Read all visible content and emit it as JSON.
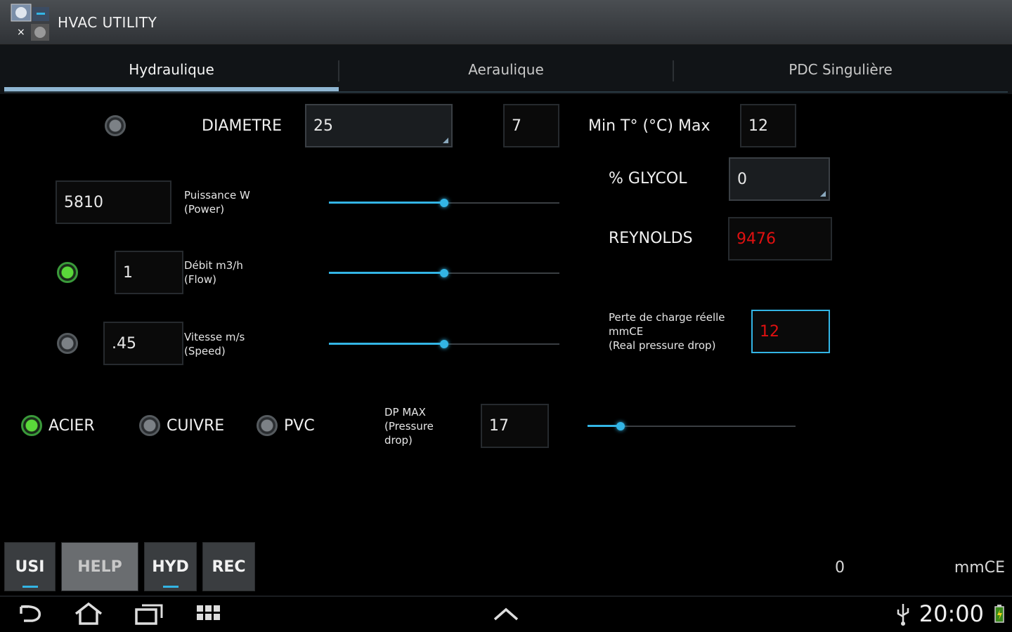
{
  "app": {
    "title": "HVAC UTILITY"
  },
  "tabs": [
    {
      "label": "Hydraulique"
    },
    {
      "label": "Aeraulique"
    },
    {
      "label": "PDC Singulière"
    }
  ],
  "diametre": {
    "label": "DIAMETRE",
    "value": "25"
  },
  "temperature": {
    "min_value": "7",
    "label": "Min  T° (°C)  Max",
    "max_value": "12"
  },
  "glycol": {
    "label": "% GLYCOL",
    "value": "0"
  },
  "reynolds": {
    "label": "REYNOLDS",
    "value": "9476"
  },
  "puissance": {
    "value": "5810",
    "label_line1": "Puissance W",
    "label_line2": "(Power)",
    "slider_fraction": 0.5
  },
  "debit": {
    "value": "1",
    "label_line1": "Débit m3/h",
    "label_line2": "(Flow)",
    "slider_fraction": 0.5
  },
  "vitesse": {
    "value": ".45",
    "label_line1": "Vitesse m/s",
    "label_line2": "(Speed)",
    "slider_fraction": 0.5
  },
  "perte": {
    "label_line1": "Perte de charge réelle",
    "label_line2": "mmCE",
    "label_line3": "(Real pressure drop)",
    "value": "12"
  },
  "materials": [
    {
      "label": "ACIER",
      "selected": true
    },
    {
      "label": "CUIVRE",
      "selected": false
    },
    {
      "label": "PVC",
      "selected": false
    }
  ],
  "dpmax": {
    "label_line1": "DP MAX",
    "label_line2": "(Pressure",
    "label_line3": "drop)",
    "value": "17",
    "slider_fraction": 0.16
  },
  "bottom_buttons": [
    {
      "label": "USI"
    },
    {
      "label": "HELP"
    },
    {
      "label": "HYD"
    },
    {
      "label": "REC"
    }
  ],
  "status": {
    "value": "0",
    "unit": "mmCE"
  },
  "system": {
    "time": "20:00"
  },
  "colors": {
    "accent": "#33b5e5",
    "alert": "#e01010",
    "radio_on": "#5ad83a"
  }
}
